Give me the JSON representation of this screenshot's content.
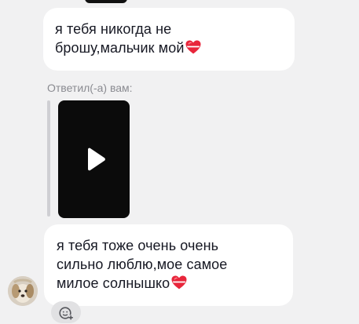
{
  "messages": [
    {
      "text_line1": "я тебя никогда не",
      "text_line2": "брошу,мальчик мой"
    },
    {
      "reply_label": "Ответил(-а) вам:",
      "text_line1": "я тебя тоже очень очень",
      "text_line2": "сильно люблю,мое самое",
      "text_line3": "милое солнышко"
    }
  ],
  "icons": {
    "heart": "red-heart-with-ribbon-icon",
    "play": "play-icon",
    "reaction": "add-reaction-icon",
    "avatar": "dog-avatar"
  },
  "colors": {
    "background": "#f1f1f2",
    "bubble": "#ffffff",
    "text": "#161823",
    "reply_label": "#8a8b91",
    "heart": "#e8263b"
  }
}
